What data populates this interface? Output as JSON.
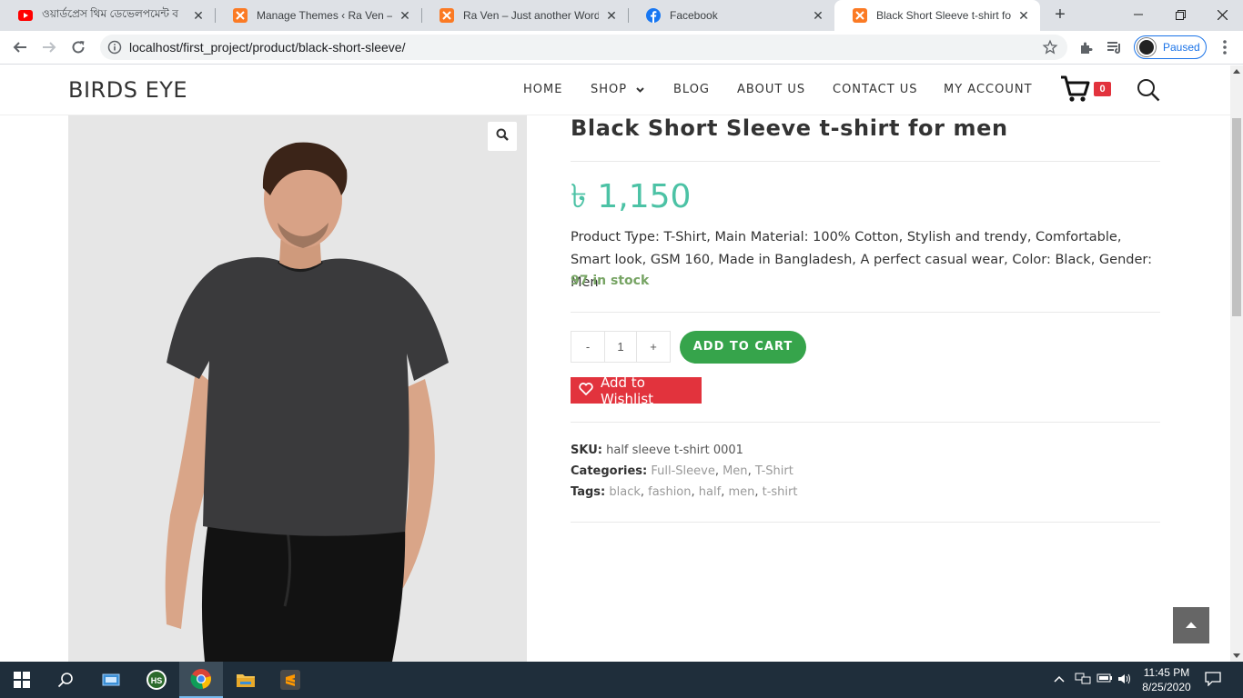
{
  "browser": {
    "tabs": [
      {
        "title": "ওয়ার্ডপ্রেস থিম ডেভেলপমেন্ট ব",
        "icon": "youtube-icon",
        "active": false
      },
      {
        "title": "Manage Themes ‹ Ra Ven — W",
        "icon": "xampp-icon",
        "active": false
      },
      {
        "title": "Ra Ven – Just another WordPre",
        "icon": "xampp-icon",
        "active": false
      },
      {
        "title": "Facebook",
        "icon": "facebook-icon",
        "active": false
      },
      {
        "title": "Black Short Sleeve t-shirt for m",
        "icon": "xampp-icon",
        "active": true
      }
    ],
    "url": "localhost/first_project/product/black-short-sleeve/",
    "profile_status": "Paused"
  },
  "site": {
    "logo": "BIRDS EYE",
    "nav": [
      {
        "label": "HOME"
      },
      {
        "label": "SHOP"
      },
      {
        "label": "BLOG"
      },
      {
        "label": "ABOUT US"
      },
      {
        "label": "CONTACT US"
      },
      {
        "label": "MY ACCOUNT"
      }
    ],
    "cart_count": "0"
  },
  "product": {
    "title": "Black Short Sleeve t-shirt for men",
    "price": "৳ 1,150",
    "description": "Product Type: T-Shirt, Main Material: 100% Cotton, Stylish and trendy, Comfortable, Smart look, GSM 160, Made in Bangladesh, A perfect casual wear, Color:  Black, Gender: Men",
    "stock": "97 in stock",
    "qty_minus": "-",
    "qty_value": "1",
    "qty_plus": "+",
    "add_to_cart": "ADD TO CART",
    "wishlist": "Add to Wishlist",
    "sku_label": "SKU:",
    "sku": "half sleeve t-shirt 0001",
    "categories_label": "Categories:",
    "categories": [
      "Full-Sleeve",
      "Men",
      "T-Shirt"
    ],
    "tags_label": "Tags:",
    "tags": [
      "black",
      "fashion",
      "half",
      "men",
      "t-shirt"
    ]
  },
  "taskbar": {
    "time": "11:45 PM",
    "date": "8/25/2020"
  },
  "colors": {
    "price": "#4cc2a5",
    "add_to_cart": "#36a44b",
    "wishlist": "#e2333d",
    "stock": "#77a464"
  }
}
